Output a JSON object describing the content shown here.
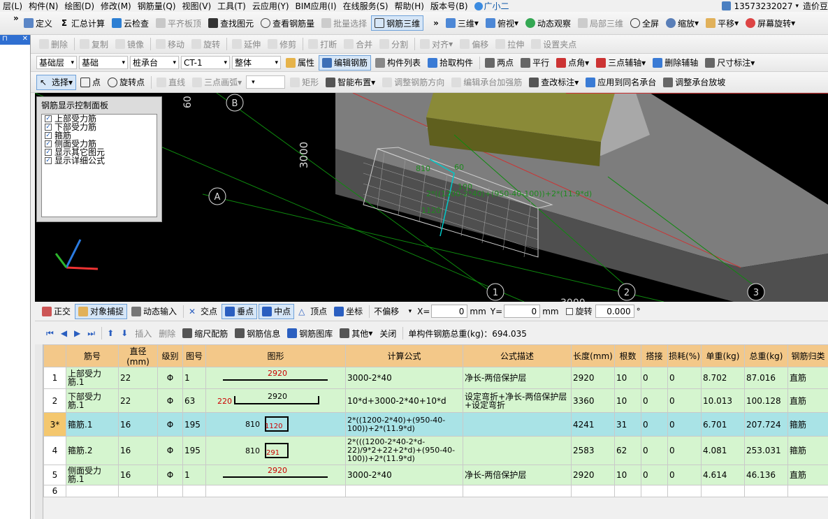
{
  "menu": [
    "层(L)",
    "构件(N)",
    "绘图(D)",
    "修改(M)",
    "钢筋量(Q)",
    "视图(V)",
    "工具(T)",
    "云应用(Y)",
    "BIM应用(I)",
    "在线服务(S)",
    "帮助(H)",
    "版本号(B)"
  ],
  "menu_right": {
    "assistant": "广小二",
    "phone": "13573232027",
    "brand": "造价豆"
  },
  "toolbar1": {
    "buttons": [
      "定义",
      "汇总计算",
      "云检查",
      "平齐板顶",
      "查找图元",
      "查看钢筋量",
      "批量选择",
      "钢筋三维",
      "三维",
      "俯视",
      "动态观察",
      "局部三维",
      "全屏",
      "缩放",
      "平移",
      "屏幕旋转"
    ]
  },
  "toolbar2": {
    "buttons": [
      "删除",
      "复制",
      "镜像",
      "移动",
      "旋转",
      "延伸",
      "修剪",
      "打断",
      "合并",
      "分割",
      "对齐",
      "偏移",
      "拉伸",
      "设置夹点"
    ]
  },
  "toolbar3": {
    "combos": [
      "基础层",
      "基础",
      "桩承台",
      "CT-1",
      "整体"
    ],
    "buttons": [
      "属性",
      "编辑钢筋",
      "构件列表",
      "拾取构件",
      "两点",
      "平行",
      "点角",
      "三点辅轴",
      "删除辅轴",
      "尺寸标注"
    ]
  },
  "toolbar4": {
    "buttons": [
      "选择",
      "点",
      "旋转点",
      "直线",
      "三点画弧",
      "矩形",
      "智能布置",
      "调整钢筋方向",
      "编辑承台加强筋",
      "查改标注",
      "应用到同名承台",
      "调整承台放坡"
    ]
  },
  "rebar_panel": {
    "title": "钢筋显示控制面板",
    "items": [
      "上部受力筋",
      "下部受力筋",
      "箍筋",
      "侧面受力筋",
      "显示其它图元",
      "显示详细公式"
    ]
  },
  "viewport": {
    "axis_labels": [
      "A",
      "B",
      "1",
      "2",
      "3"
    ],
    "dims": [
      "3000",
      "3000",
      "60"
    ],
    "annotations": [
      "2*((1200-2*40)+(950-40-100))+2*(11.9*d)",
      "1120",
      "810",
      "100",
      "60"
    ]
  },
  "snap": {
    "items": [
      "正交",
      "对象捕捉",
      "动态输入",
      "交点",
      "垂点",
      "中点",
      "顶点",
      "坐标",
      "不偏移",
      "X=",
      "mm",
      "Y=",
      "mm",
      "旋转"
    ],
    "x": "0",
    "y": "0",
    "rot": "0.000"
  },
  "gridtool": {
    "buttons": [
      "插入",
      "删除",
      "缩尺配筋",
      "钢筋信息",
      "钢筋图库",
      "其他",
      "关闭"
    ],
    "weight_label": "单构件钢筋总重(kg)：694.035"
  },
  "grid": {
    "headers": [
      "",
      "筋号",
      "直径(mm)",
      "级别",
      "图号",
      "图形",
      "计算公式",
      "公式描述",
      "长度(mm)",
      "根数",
      "搭接",
      "损耗(%)",
      "单重(kg)",
      "总重(kg)",
      "钢筋归类"
    ],
    "rows": [
      {
        "n": "1",
        "name": "上部受力筋.1",
        "dia": "22",
        "grade": "Φ",
        "fig": "1",
        "shape_left": "",
        "shape_mid": "2920",
        "formula": "3000-2*40",
        "desc": "净长-两倍保护层",
        "len": "2920",
        "count": "10",
        "lap": "0",
        "loss": "0",
        "unit": "8.702",
        "total": "87.016",
        "cat": "直筋"
      },
      {
        "n": "2",
        "name": "下部受力筋.1",
        "dia": "22",
        "grade": "Φ",
        "fig": "63",
        "shape_left": "220",
        "shape_mid": "2920",
        "formula": "10*d+3000-2*40+10*d",
        "desc": "设定弯折+净长-两倍保护层+设定弯折",
        "len": "3360",
        "count": "10",
        "lap": "0",
        "loss": "0",
        "unit": "10.013",
        "total": "100.128",
        "cat": "直筋"
      },
      {
        "n": "3*",
        "name": "箍筋.1",
        "dia": "16",
        "grade": "Φ",
        "fig": "195",
        "shape_left": "810",
        "shape_mid": "1120",
        "formula": "2*((1200-2*40)+(950-40-100))+2*(11.9*d)",
        "desc": "",
        "len": "4241",
        "count": "31",
        "lap": "0",
        "loss": "0",
        "unit": "6.701",
        "total": "207.724",
        "cat": "箍筋"
      },
      {
        "n": "4",
        "name": "箍筋.2",
        "dia": "16",
        "grade": "Φ",
        "fig": "195",
        "shape_left": "810",
        "shape_mid": "291",
        "formula": "2*(((1200-2*40-2*d-22)/9*2+22+2*d)+(950-40-100))+2*(11.9*d)",
        "desc": "",
        "len": "2583",
        "count": "62",
        "lap": "0",
        "loss": "0",
        "unit": "4.081",
        "total": "253.031",
        "cat": "箍筋"
      },
      {
        "n": "5",
        "name": "侧面受力筋.1",
        "dia": "16",
        "grade": "Φ",
        "fig": "1",
        "shape_left": "",
        "shape_mid": "2920",
        "formula": "3000-2*40",
        "desc": "净长-两倍保护层",
        "len": "2920",
        "count": "10",
        "lap": "0",
        "loss": "0",
        "unit": "4.614",
        "total": "46.136",
        "cat": "直筋"
      }
    ],
    "empty_row": "6"
  }
}
